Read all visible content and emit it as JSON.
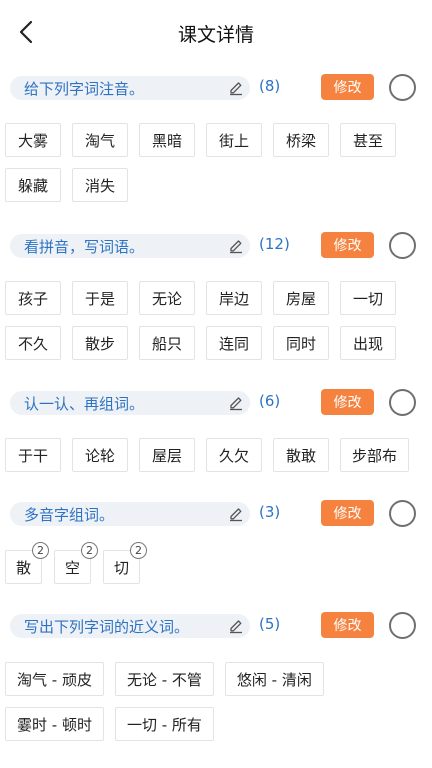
{
  "header": {
    "title": "课文详情"
  },
  "sections": [
    {
      "title": "给下列字词注音。",
      "count": "(8)",
      "edit_label": "修改",
      "items": [
        "大雾",
        "淘气",
        "黑暗",
        "街上",
        "桥梁",
        "甚至",
        "躲藏",
        "消失"
      ]
    },
    {
      "title": "看拼音，写词语。",
      "count": "(12)",
      "edit_label": "修改",
      "items": [
        "孩子",
        "于是",
        "无论",
        "岸边",
        "房屋",
        "一切",
        "不久",
        "散步",
        "船只",
        "连同",
        "同时",
        "出现"
      ]
    },
    {
      "title": "认一认、再组词。",
      "count": "(6)",
      "edit_label": "修改",
      "items": [
        "于干",
        "论轮",
        "屋层",
        "久欠",
        "散敢",
        "步部布"
      ]
    },
    {
      "title": "多音字组词。",
      "count": "(3)",
      "edit_label": "修改",
      "items": [
        {
          "char": "散",
          "badge": "2"
        },
        {
          "char": "空",
          "badge": "2"
        },
        {
          "char": "切",
          "badge": "2"
        }
      ]
    },
    {
      "title": "写出下列字词的近义词。",
      "count": "(5)",
      "edit_label": "修改",
      "items": [
        "淘气 - 顽皮",
        "无论 - 不管",
        "悠闲 - 清闲",
        "霎时 - 顿时",
        "一切 - 所有"
      ]
    }
  ],
  "colors": {
    "accent_blue": "#2d73c4",
    "edit_orange": "#f5823f",
    "pill_bg": "#eef1f5"
  }
}
